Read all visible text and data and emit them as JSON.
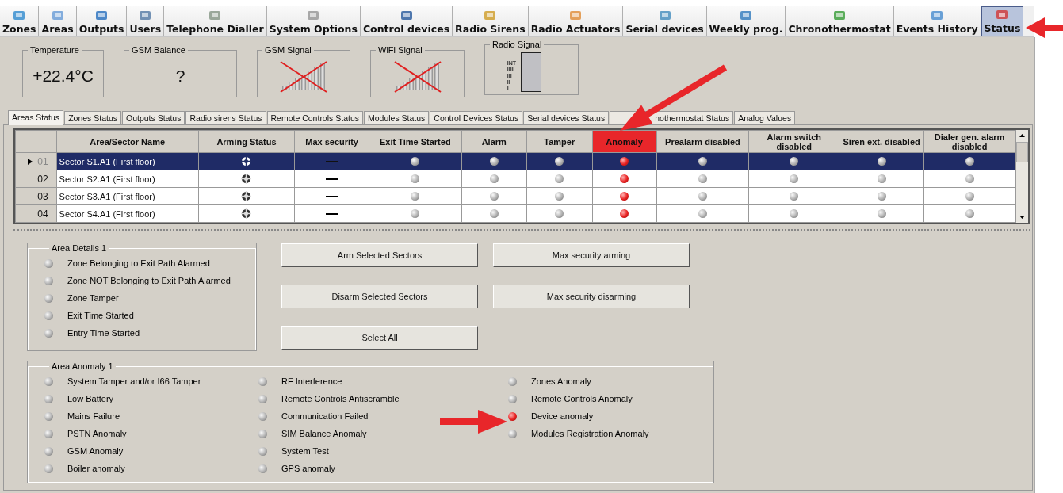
{
  "toolbar": [
    {
      "label": "Zones",
      "selected": false
    },
    {
      "label": "Areas",
      "selected": false
    },
    {
      "label": "Outputs",
      "selected": false
    },
    {
      "label": "Users",
      "selected": false
    },
    {
      "label": "Telephone Dialler",
      "selected": false
    },
    {
      "label": "System Options",
      "selected": false
    },
    {
      "label": "Control devices",
      "selected": false
    },
    {
      "label": "Radio Sirens",
      "selected": false
    },
    {
      "label": "Radio Actuators",
      "selected": false
    },
    {
      "label": "Serial devices",
      "selected": false
    },
    {
      "label": "Weekly prog.",
      "selected": false
    },
    {
      "label": "Chronothermostat",
      "selected": false
    },
    {
      "label": "Events History",
      "selected": false
    },
    {
      "label": "Status",
      "selected": true
    }
  ],
  "gauges": [
    {
      "kind": "value",
      "title": "Temperature",
      "value": "+22.4°C"
    },
    {
      "kind": "value",
      "title": "GSM Balance",
      "value": "?"
    },
    {
      "kind": "signal",
      "title": "GSM Signal",
      "available": false
    },
    {
      "kind": "signal",
      "title": "WiFi Signal",
      "available": false
    },
    {
      "kind": "radio",
      "title": "Radio Signal",
      "scale": [
        "INT",
        "IIII",
        "III",
        "II",
        "I"
      ]
    }
  ],
  "status_tabs": [
    {
      "label": "Areas Status",
      "selected": true
    },
    {
      "label": "Zones Status",
      "selected": false
    },
    {
      "label": "Outputs Status",
      "selected": false
    },
    {
      "label": "Radio sirens Status",
      "selected": false
    },
    {
      "label": "Remote Controls Status",
      "selected": false
    },
    {
      "label": "Modules Status",
      "selected": false
    },
    {
      "label": "Control Devices Status",
      "selected": false
    },
    {
      "label": "Serial devices Status",
      "selected": false
    },
    {
      "label": "nothermostat Status",
      "selected": false
    },
    {
      "label": "Analog Values",
      "selected": false
    }
  ],
  "table": {
    "columns": [
      {
        "label": "Area/Sector Name",
        "highlighted": false
      },
      {
        "label": "Arming Status",
        "highlighted": false
      },
      {
        "label": "Max security",
        "highlighted": false
      },
      {
        "label": "Exit Time Started",
        "highlighted": false
      },
      {
        "label": "Alarm",
        "highlighted": false
      },
      {
        "label": "Tamper",
        "highlighted": false
      },
      {
        "label": "Anomaly",
        "highlighted": true
      },
      {
        "label": "Prealarm disabled",
        "highlighted": false
      },
      {
        "label": "Alarm switch disabled",
        "highlighted": false
      },
      {
        "label": "Siren ext. disabled",
        "highlighted": false
      },
      {
        "label": "Dialer gen. alarm disabled",
        "highlighted": false
      }
    ],
    "rows": [
      {
        "number": "01",
        "name": "Sector S1.A1 (First floor)",
        "selected": true,
        "leds": [
          false,
          false,
          false,
          true,
          false,
          false,
          false,
          false
        ]
      },
      {
        "number": "02",
        "name": "Sector S2.A1 (First floor)",
        "selected": false,
        "leds": [
          false,
          false,
          false,
          true,
          false,
          false,
          false,
          false
        ]
      },
      {
        "number": "03",
        "name": "Sector S3.A1 (First floor)",
        "selected": false,
        "leds": [
          false,
          false,
          false,
          true,
          false,
          false,
          false,
          false
        ]
      },
      {
        "number": "04",
        "name": "Sector S4.A1 (First floor)",
        "selected": false,
        "leds": [
          false,
          false,
          false,
          true,
          false,
          false,
          false,
          false
        ]
      }
    ]
  },
  "area_details": {
    "title": "Area Details 1",
    "items": [
      {
        "label": "Zone Belonging to Exit Path Alarmed",
        "on": false
      },
      {
        "label": "Zone NOT Belonging to Exit Path Alarmed",
        "on": false
      },
      {
        "label": "Zone Tamper",
        "on": false
      },
      {
        "label": "Exit Time Started",
        "on": false
      },
      {
        "label": "Entry Time Started",
        "on": false
      }
    ]
  },
  "buttons": [
    [
      "Arm Selected Sectors",
      "Max security arming"
    ],
    [
      "Disarm Selected Sectors",
      "Max security disarming"
    ],
    [
      "Select All"
    ]
  ],
  "area_anomaly": {
    "title": "Area Anomaly 1",
    "columns": [
      [
        {
          "label": "System Tamper and/or I66 Tamper",
          "on": false
        },
        {
          "label": "Low Battery",
          "on": false
        },
        {
          "label": "Mains Failure",
          "on": false
        },
        {
          "label": "PSTN Anomaly",
          "on": false
        },
        {
          "label": "GSM Anomaly",
          "on": false
        },
        {
          "label": "Boiler anomaly",
          "on": false
        }
      ],
      [
        {
          "label": "RF Interference",
          "on": false
        },
        {
          "label": "Remote Controls Antiscramble",
          "on": false
        },
        {
          "label": "Communication Failed",
          "on": false
        },
        {
          "label": "SIM Balance Anomaly",
          "on": false
        },
        {
          "label": "System Test",
          "on": false
        },
        {
          "label": "GPS anomaly",
          "on": false
        }
      ],
      [
        {
          "label": "Zones Anomaly",
          "on": false
        },
        {
          "label": "Remote Controls Anomaly",
          "on": false
        },
        {
          "label": "Device anomaly",
          "on": true
        },
        {
          "label": "Modules Registration Anomaly",
          "on": false
        }
      ]
    ]
  }
}
